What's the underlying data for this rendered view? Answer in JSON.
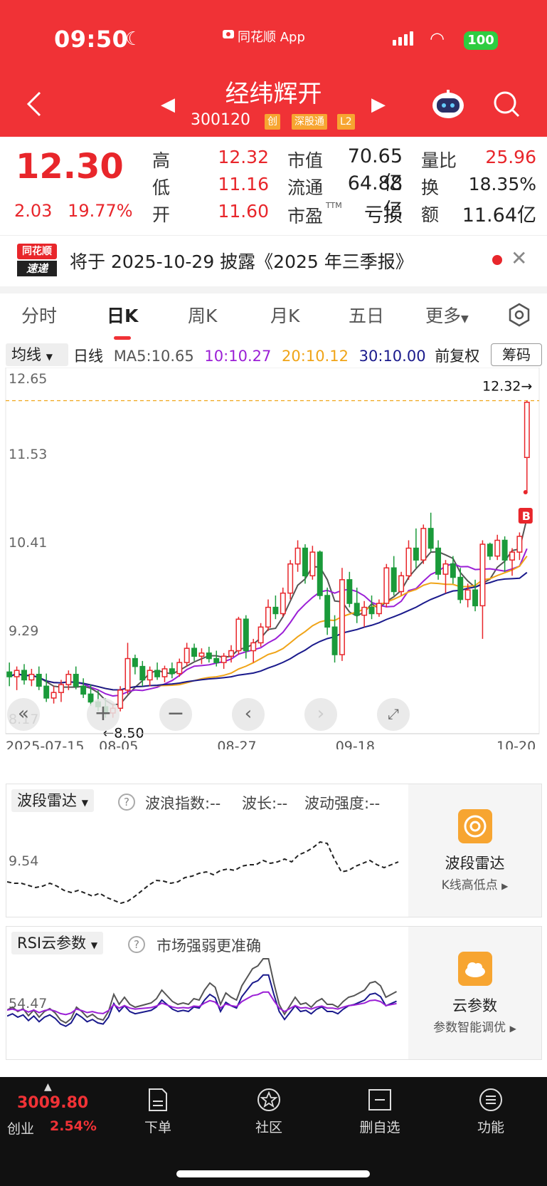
{
  "status_bar": {
    "time": "09:50",
    "app_name": "同花顺 App",
    "battery": "100"
  },
  "header": {
    "stock_name": "经纬辉开",
    "stock_code": "300120",
    "tags": [
      "创",
      "深股通",
      "L2"
    ]
  },
  "quote": {
    "price": "12.30",
    "change": "2.03",
    "change_pct": "19.77%",
    "fields": [
      {
        "label": "高",
        "value": "12.32"
      },
      {
        "label": "低",
        "value": "11.16"
      },
      {
        "label": "开",
        "value": "11.60"
      },
      {
        "label": "市值",
        "value": "70.65亿"
      },
      {
        "label": "流通",
        "value": "64.88亿"
      },
      {
        "label": "市盈",
        "value": "亏损"
      },
      {
        "label": "量比",
        "value": "25.96"
      },
      {
        "label": "换",
        "value": "18.35%"
      },
      {
        "label": "额",
        "value": "11.64亿"
      }
    ],
    "ttm": "TTM"
  },
  "notice": {
    "logo_top": "同花顺",
    "logo_bottom": "速递",
    "text": "将于 2025-10-29 披露《2025 年三季报》"
  },
  "tabs": [
    "分时",
    "日K",
    "周K",
    "月K",
    "五日",
    "更多"
  ],
  "ma_bar": {
    "selector": "均线",
    "period": "日线",
    "ma5": "MA5:10.65",
    "ma10": "10:10.27",
    "ma20": "20:10.12",
    "ma30": "30:10.00",
    "adjust": "前复权",
    "chip_button": "筹码"
  },
  "colors": {
    "up": "#e8262b",
    "down": "#1a9a3a",
    "ma5": "#555555",
    "ma10": "#9b1fd6",
    "ma20": "#f0a418",
    "ma30": "#1a1a8c"
  },
  "chart_data": {
    "type": "candlestick",
    "y_ticks": [
      "12.65",
      "11.53",
      "10.41",
      "9.29",
      "8.17"
    ],
    "ylim": [
      8.17,
      12.65
    ],
    "x_labels": [
      "2025-07-15",
      "08-05",
      "08-27",
      "09-18",
      "10-20"
    ],
    "annotations": {
      "high": "12.32→",
      "low": "←8.50",
      "buy_marker": "B"
    },
    "candles": [
      [
        8.88,
        9.0,
        8.7,
        8.82
      ],
      [
        8.82,
        8.95,
        8.65,
        8.9
      ],
      [
        8.9,
        8.98,
        8.72,
        8.78
      ],
      [
        8.78,
        8.92,
        8.7,
        8.85
      ],
      [
        8.85,
        8.95,
        8.65,
        8.7
      ],
      [
        8.7,
        8.86,
        8.5,
        8.55
      ],
      [
        8.55,
        8.7,
        8.48,
        8.62
      ],
      [
        8.62,
        8.78,
        8.5,
        8.72
      ],
      [
        8.72,
        8.9,
        8.65,
        8.85
      ],
      [
        8.85,
        8.95,
        8.66,
        8.7
      ],
      [
        8.7,
        8.8,
        8.55,
        8.6
      ],
      [
        8.6,
        8.72,
        8.45,
        8.5
      ],
      [
        8.5,
        8.65,
        8.38,
        8.44
      ],
      [
        8.44,
        8.55,
        8.3,
        8.36
      ],
      [
        8.36,
        8.48,
        8.3,
        8.42
      ],
      [
        8.42,
        8.7,
        8.38,
        8.65
      ],
      [
        8.65,
        9.25,
        8.6,
        9.05
      ],
      [
        9.05,
        9.1,
        8.85,
        8.95
      ],
      [
        8.95,
        9.02,
        8.7,
        8.78
      ],
      [
        8.78,
        8.95,
        8.7,
        8.9
      ],
      [
        8.9,
        9.0,
        8.78,
        8.82
      ],
      [
        8.82,
        8.96,
        8.75,
        8.92
      ],
      [
        8.92,
        9.0,
        8.8,
        8.86
      ],
      [
        8.86,
        9.05,
        8.82,
        9.0
      ],
      [
        9.0,
        9.25,
        8.95,
        9.18
      ],
      [
        9.18,
        9.24,
        9.02,
        9.08
      ],
      [
        9.08,
        9.18,
        8.98,
        9.12
      ],
      [
        9.12,
        9.2,
        9.0,
        9.05
      ],
      [
        9.05,
        9.15,
        8.95,
        9.0
      ],
      [
        9.0,
        9.12,
        8.92,
        9.08
      ],
      [
        9.08,
        9.22,
        9.0,
        9.15
      ],
      [
        9.15,
        9.58,
        9.1,
        9.55
      ],
      [
        9.55,
        9.6,
        9.05,
        9.15
      ],
      [
        9.15,
        9.3,
        9.0,
        9.25
      ],
      [
        9.25,
        9.5,
        9.2,
        9.45
      ],
      [
        9.45,
        9.8,
        9.4,
        9.7
      ],
      [
        9.7,
        9.85,
        9.55,
        9.62
      ],
      [
        9.62,
        9.95,
        9.58,
        9.88
      ],
      [
        9.88,
        10.3,
        9.8,
        10.25
      ],
      [
        10.25,
        10.55,
        10.15,
        10.45
      ],
      [
        10.45,
        10.5,
        10.0,
        10.1
      ],
      [
        10.1,
        10.48,
        10.05,
        10.4
      ],
      [
        10.4,
        10.42,
        9.8,
        9.85
      ],
      [
        9.85,
        9.95,
        9.35,
        9.45
      ],
      [
        9.45,
        9.6,
        9.0,
        9.1
      ],
      [
        9.1,
        10.2,
        9.02,
        10.05
      ],
      [
        10.05,
        10.15,
        9.7,
        9.75
      ],
      [
        9.75,
        9.95,
        9.5,
        9.6
      ],
      [
        9.6,
        9.78,
        9.45,
        9.7
      ],
      [
        9.7,
        9.85,
        9.55,
        9.62
      ],
      [
        9.62,
        9.8,
        9.58,
        9.75
      ],
      [
        9.75,
        10.25,
        9.7,
        10.2
      ],
      [
        10.2,
        10.35,
        9.85,
        9.9
      ],
      [
        9.9,
        10.15,
        9.85,
        10.1
      ],
      [
        10.1,
        10.55,
        10.05,
        10.45
      ],
      [
        10.45,
        10.7,
        10.2,
        10.3
      ],
      [
        10.3,
        10.75,
        10.25,
        10.7
      ],
      [
        10.7,
        10.9,
        10.4,
        10.45
      ],
      [
        10.45,
        10.55,
        10.05,
        10.12
      ],
      [
        10.12,
        10.3,
        9.88,
        10.25
      ],
      [
        10.25,
        10.35,
        10.0,
        10.08
      ],
      [
        10.08,
        10.2,
        9.75,
        9.8
      ],
      [
        9.8,
        10.0,
        9.7,
        9.92
      ],
      [
        9.92,
        10.05,
        9.65,
        9.72
      ],
      [
        9.72,
        10.55,
        9.3,
        10.5
      ],
      [
        10.5,
        10.52,
        10.3,
        10.35
      ],
      [
        10.35,
        10.62,
        10.3,
        10.55
      ],
      [
        10.55,
        10.6,
        10.15,
        10.3
      ],
      [
        10.3,
        10.45,
        10.1,
        10.4
      ],
      [
        10.4,
        10.65,
        10.3,
        10.6
      ],
      [
        11.6,
        12.32,
        11.16,
        12.3
      ]
    ]
  },
  "wave_panel": {
    "selector": "波段雷达",
    "fields": [
      "波浪指数:--",
      "波长:--",
      "波动强度:--"
    ],
    "y_label": "9.54",
    "side_title": "波段雷达",
    "side_sub": "K线高低点"
  },
  "rsi_panel": {
    "selector": "RSI云参数",
    "tip": "市场强弱更准确",
    "y_label": "54.47",
    "side_title": "云参数",
    "side_sub": "参数智能调优"
  },
  "bottom_bar": {
    "index_value": "3009.80",
    "index_name": "创业",
    "index_change": "2.54%",
    "items": [
      "下单",
      "社区",
      "删自选",
      "功能"
    ]
  }
}
